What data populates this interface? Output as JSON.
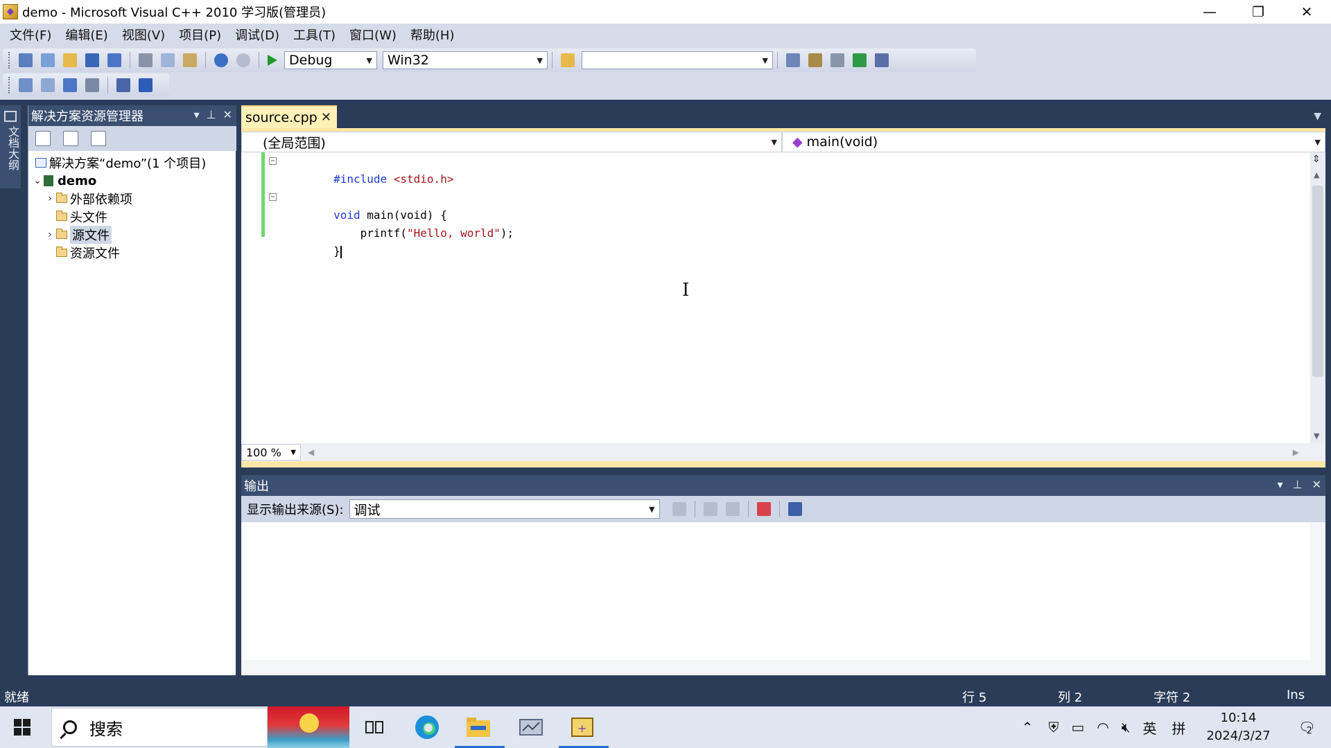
{
  "window": {
    "title": "demo - Microsoft Visual C++ 2010 学习版(管理员)",
    "minimize": "—",
    "restore": "❐",
    "close": "✕"
  },
  "menu": [
    "文件(F)",
    "编辑(E)",
    "视图(V)",
    "项目(P)",
    "调试(D)",
    "工具(T)",
    "窗口(W)",
    "帮助(H)"
  ],
  "toolbar": {
    "config": "Debug",
    "platform": "Win32",
    "find": ""
  },
  "side_tab": {
    "label": "文档大纲"
  },
  "solution_explorer": {
    "title": "解决方案资源管理器",
    "tree": {
      "solution": "解决方案“demo”(1 个项目)",
      "project": "demo",
      "external_deps": "外部依赖项",
      "headers": "头文件",
      "sources": "源文件",
      "resources": "资源文件"
    }
  },
  "editor": {
    "tab": "source.cpp",
    "scope": "(全局范围)",
    "function": "main(void)",
    "code": {
      "l1_kw": "#include",
      "l1_str": " <stdio.h>",
      "l3_kw": "void",
      "l3_rest": " main(void) {",
      "l4_fn": "    printf(",
      "l4_str": "\"Hello, world\"",
      "l4_end": ");",
      "l5": "}"
    },
    "zoom": "100 %"
  },
  "output": {
    "title": "输出",
    "source_label": "显示输出来源(S):",
    "source_value": "调试"
  },
  "status": {
    "ready": "就绪",
    "line": "行 5",
    "col": "列 2",
    "char": "字符 2",
    "mode": "Ins"
  },
  "taskbar": {
    "search": "搜索",
    "time": "10:14",
    "date": "2024/3/27",
    "ime_lang": "英",
    "ime_mode": "拼",
    "notifications": "2"
  },
  "colors": {
    "chrome": "#2b3c59",
    "panel_header": "#3b4f71",
    "active_tab": "#fff1b8",
    "keyword": "#1c3bd7",
    "string": "#a3151a",
    "change_bar": "#6dd86d"
  }
}
